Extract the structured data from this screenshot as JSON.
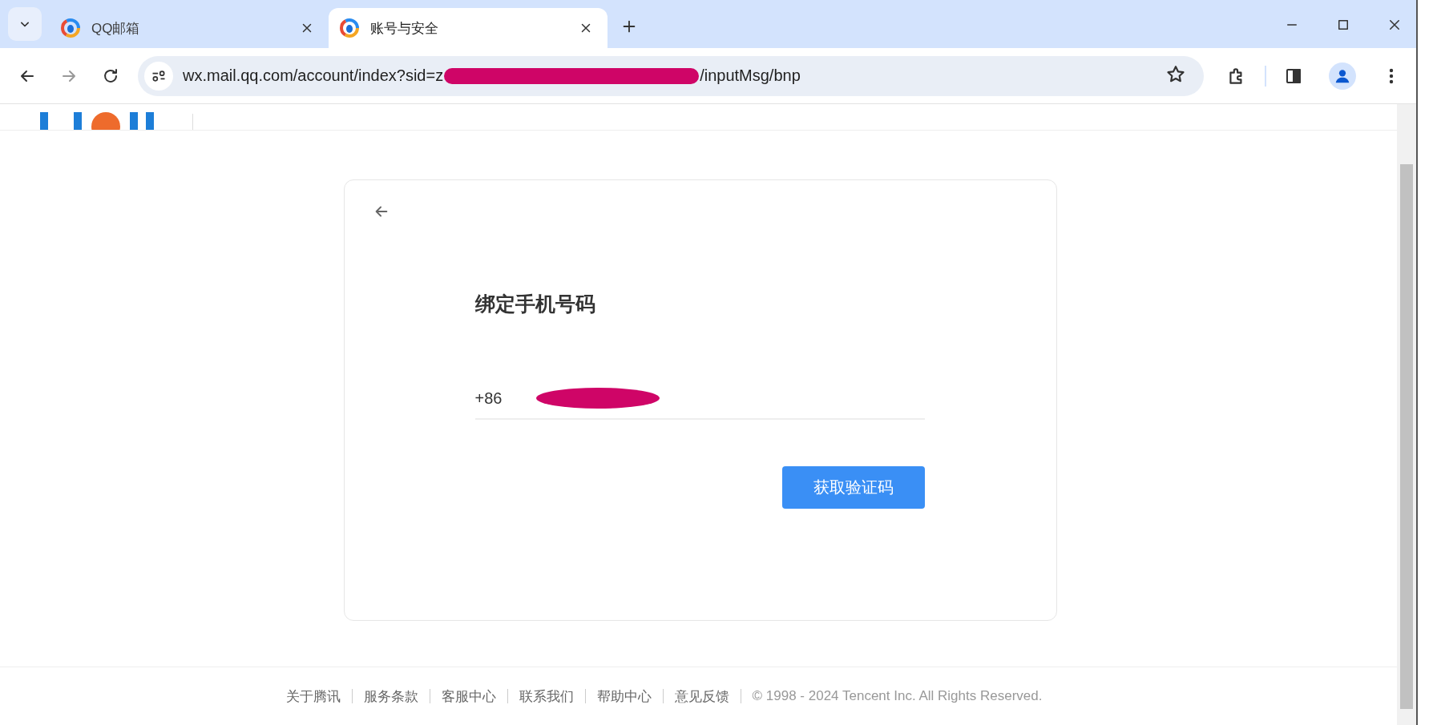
{
  "browser": {
    "tabs": [
      {
        "title": "QQ邮箱",
        "selected": false
      },
      {
        "title": "账号与安全",
        "selected": true
      }
    ],
    "address": {
      "before_redaction": "wx.mail.qq.com/account/index?sid=z",
      "after_redaction": "/inputMsg/bnp"
    }
  },
  "card": {
    "title": "绑定手机号码",
    "phone": {
      "country_code": "+86"
    },
    "button": "获取验证码"
  },
  "footer": {
    "links": [
      "关于腾讯",
      "服务条款",
      "客服中心",
      "联系我们",
      "帮助中心",
      "意见反馈"
    ],
    "copyright": "© 1998 - 2024 Tencent Inc. All Rights Reserved."
  }
}
